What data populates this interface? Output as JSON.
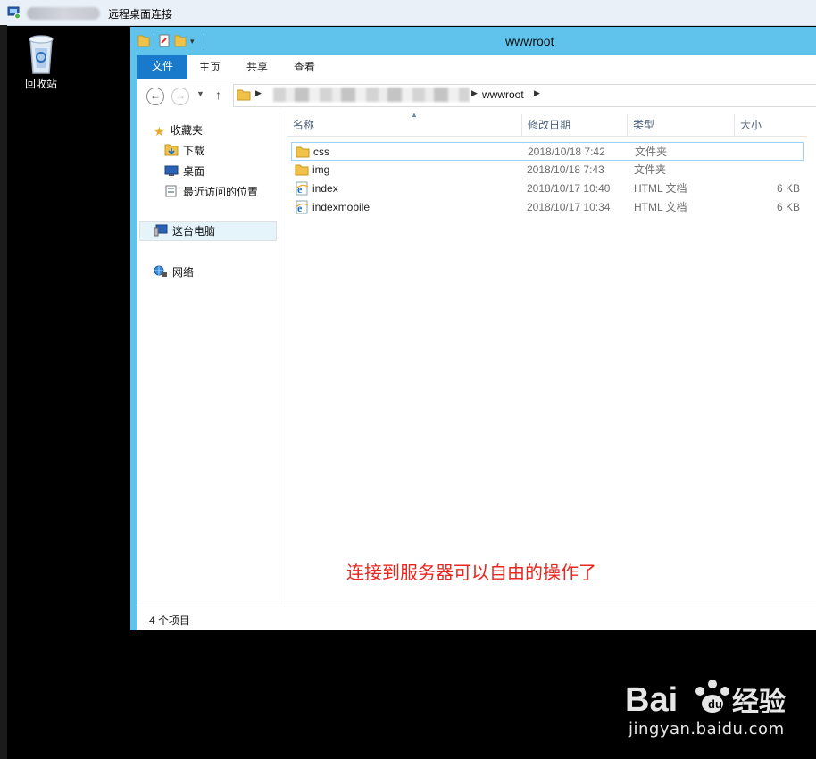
{
  "rdp": {
    "title": "远程桌面连接"
  },
  "desktop": {
    "recycle_bin_label": "回收站"
  },
  "explorer": {
    "title": "wwwroot",
    "ribbon_tabs": [
      "文件",
      "主页",
      "共享",
      "查看"
    ],
    "address_current": "wwwroot",
    "nav": {
      "favorites": "收藏夹",
      "downloads": "下载",
      "desktop": "桌面",
      "recent": "最近访问的位置",
      "this_pc": "这台电脑",
      "network": "网络"
    },
    "columns": [
      "名称",
      "修改日期",
      "类型",
      "大小"
    ],
    "files": [
      {
        "name": "css",
        "date": "2018/10/18 7:42",
        "type": "文件夹",
        "size": "",
        "icon": "folder-icon",
        "selected": true
      },
      {
        "name": "img",
        "date": "2018/10/18 7:43",
        "type": "文件夹",
        "size": "",
        "icon": "folder-icon",
        "selected": false
      },
      {
        "name": "index",
        "date": "2018/10/17 10:40",
        "type": "HTML 文档",
        "size": "6 KB",
        "icon": "ie-html-icon",
        "selected": false
      },
      {
        "name": "indexmobile",
        "date": "2018/10/17 10:34",
        "type": "HTML 文档",
        "size": "6 KB",
        "icon": "ie-html-icon",
        "selected": false
      }
    ],
    "annotation": "连接到服务器可以自由的操作了",
    "status": "4 个项目"
  },
  "watermark": {
    "brand": "Bai",
    "brand2": "经验",
    "url": "jingyan.baidu.com"
  },
  "colors": {
    "accent": "#1979ca",
    "titlebar": "#5fc3ec",
    "annotation": "#e9261f"
  }
}
